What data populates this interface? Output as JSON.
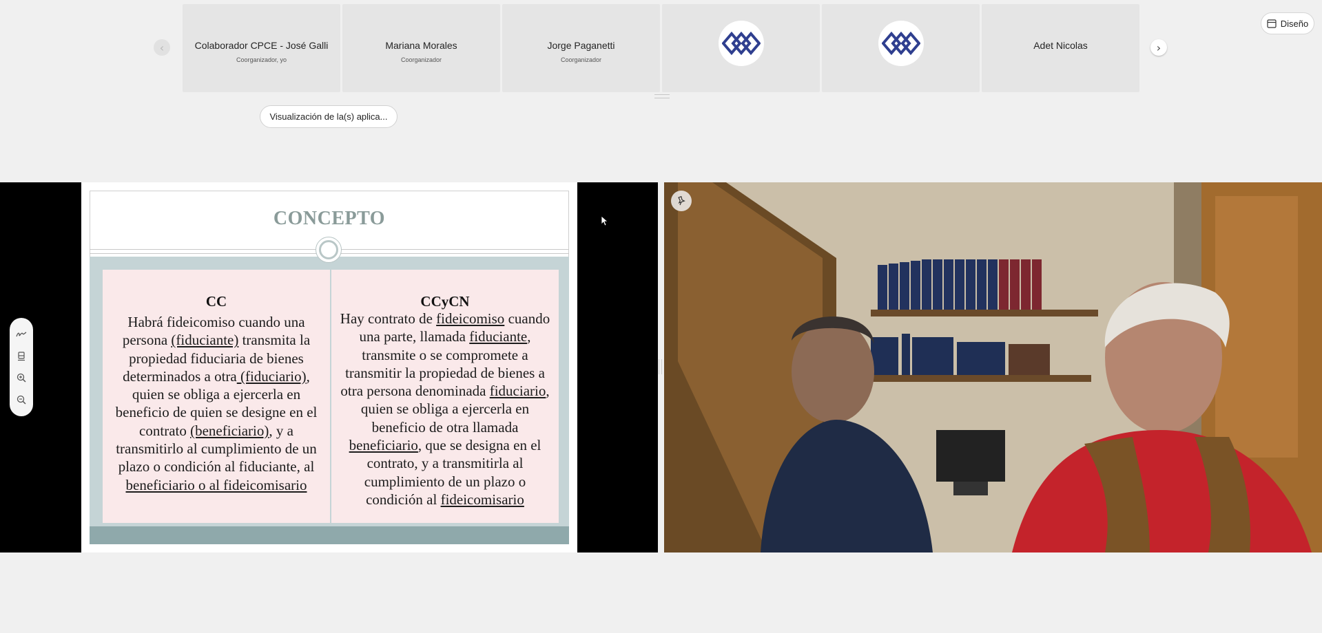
{
  "design_button": {
    "label": "Diseño",
    "icon": "calendar-layout-icon"
  },
  "participants": [
    {
      "name": "Colaborador CPCE - José Galli",
      "role": "Coorganizador, yo"
    },
    {
      "name": "Mariana Morales",
      "role": "Coorganizador"
    },
    {
      "name": "Jorge Paganetti",
      "role": "Coorganizador"
    },
    {
      "name": "",
      "role": "",
      "avatar": "cpce-logo"
    },
    {
      "name": "",
      "role": "",
      "avatar": "cpce-logo"
    },
    {
      "name": "Adet Nicolas",
      "role": ""
    }
  ],
  "apps_button": {
    "label": "Visualización de la(s) aplica..."
  },
  "slide": {
    "title": "CONCEPTO",
    "left_column": {
      "heading": "CC",
      "text_1": "Habrá fideicomiso cuando una persona ",
      "u_1": "(fiduciante)",
      "text_2": " transmita la propiedad fiduciaria de bienes determinados a otra",
      "u_2": " (fiduciario)",
      "text_3": ", quien se obliga a ejercerla en beneficio de quien se designe en el contrato ",
      "u_3": "(beneficiario)",
      "text_4": ", y a transmitirlo al cumplimiento de un plazo o condición al fiduciante, al ",
      "u_4": "beneficiario o al fideicomisario"
    },
    "right_column": {
      "heading": "CCyCN",
      "text_1": "Hay contrato de ",
      "u_1": "fideicomiso",
      "text_2": " cuando una parte, llamada ",
      "u_2": "fiduciante",
      "text_3": ", transmite o se compromete a transmitir la propiedad de bienes a otra persona denominada ",
      "u_3": "fiduciario",
      "text_4": ", quien se obliga a ejercerla en beneficio de otra llamada ",
      "u_4": "beneficiario",
      "text_5": ", que se designa en el contrato, y a transmitirla al cumplimiento de un plazo o condición al ",
      "u_5": "fideicomisario"
    }
  },
  "slide_tools": [
    "pen-icon",
    "eraser-icon",
    "zoom-in-icon",
    "zoom-out-icon"
  ],
  "colors": {
    "stage_bg": "#000000",
    "slide_title": "#8a9b99",
    "slide_band": "#c5d4d6",
    "slide_panel": "#fae9ea",
    "slide_bottom_band": "#8fa9ab",
    "logo_blue": "#2f3f8f"
  }
}
